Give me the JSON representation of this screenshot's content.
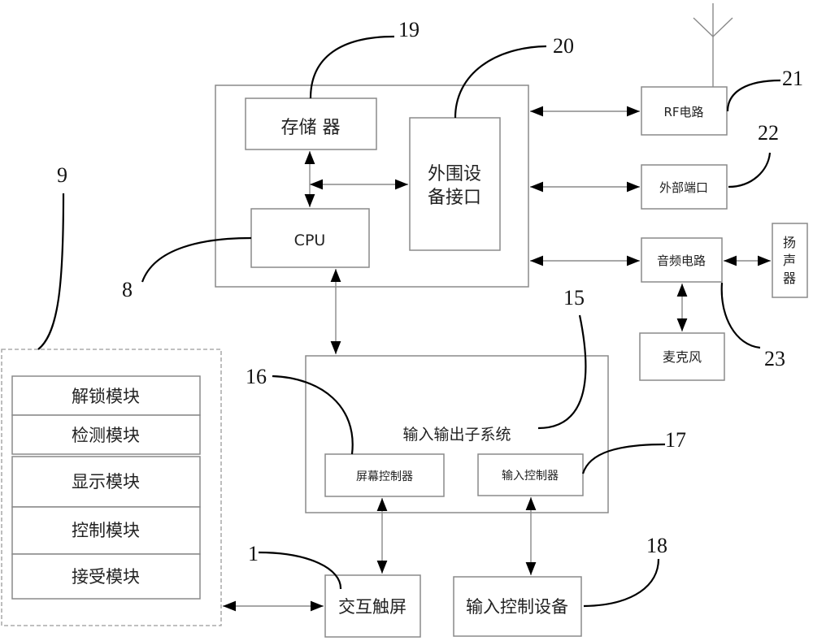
{
  "diagram": {
    "main_unit": {
      "memory": "存储 器",
      "cpu": "CPU",
      "peripheral_interface": [
        "外围设",
        "备接口"
      ]
    },
    "right_blocks": {
      "rf_circuit": "RF电路",
      "external_port": "外部端口",
      "audio_circuit": "音频电路",
      "speaker": [
        "扬",
        "声",
        "器"
      ],
      "microphone": "麦克风"
    },
    "io_subsystem": {
      "title": "输入输出子系统",
      "screen_controller": "屏幕控制器",
      "input_controller": "输入控制器"
    },
    "bottom_blocks": {
      "touchscreen": "交互触屏",
      "input_control_device": "输入控制设备"
    },
    "module_group": {
      "modules": [
        "解锁模块",
        "检测模块",
        "显示模块",
        "控制模块",
        "接受模块"
      ]
    },
    "reference_numbers": {
      "n1": "1",
      "n8": "8",
      "n9": "9",
      "n15": "15",
      "n16": "16",
      "n17": "17",
      "n18": "18",
      "n19": "19",
      "n20": "20",
      "n21": "21",
      "n22": "22",
      "n23": "23"
    }
  }
}
